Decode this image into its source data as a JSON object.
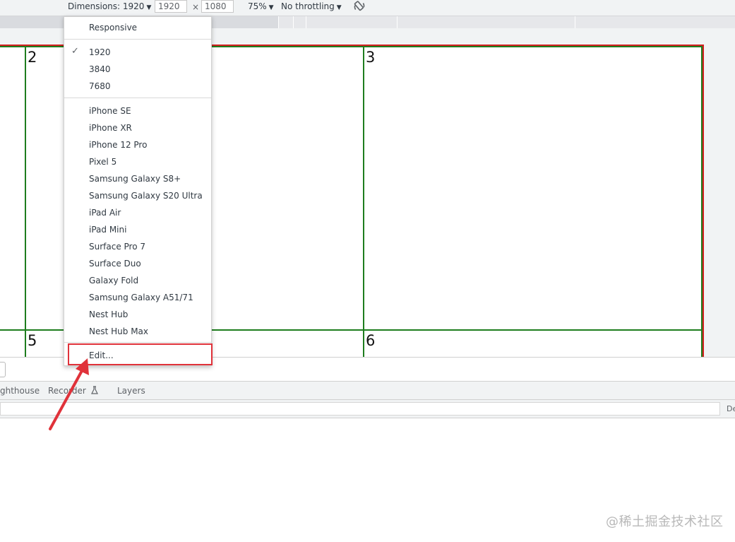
{
  "toolbar": {
    "dimensions_label": "Dimensions: 1920",
    "width_value": "1920",
    "times": "×",
    "height_value": "1080",
    "zoom_label": "75%",
    "throttle_label": "No throttling",
    "rotate_icon": "rotate-icon"
  },
  "cells": [
    "2",
    "3",
    "5",
    "6"
  ],
  "menu": {
    "responsive": "Responsive",
    "sizes": [
      "1920",
      "3840",
      "7680"
    ],
    "selected_size": "1920",
    "devices": [
      "iPhone SE",
      "iPhone XR",
      "iPhone 12 Pro",
      "Pixel 5",
      "Samsung Galaxy S8+",
      "Samsung Galaxy S20 Ultra",
      "iPad Air",
      "iPad Mini",
      "Surface Pro 7",
      "Surface Duo",
      "Galaxy Fold",
      "Samsung Galaxy A51/71",
      "Nest Hub",
      "Nest Hub Max"
    ],
    "edit": "Edit..."
  },
  "devtools": {
    "tabs": [
      "ghthouse",
      "Recorder",
      "Layers"
    ],
    "filter_right": "De"
  },
  "watermark": "@稀土掘金技术社区",
  "colors": {
    "page_border": "#d21f1f",
    "cell_border": "#1e7d1e",
    "highlight": "#e0323a"
  }
}
